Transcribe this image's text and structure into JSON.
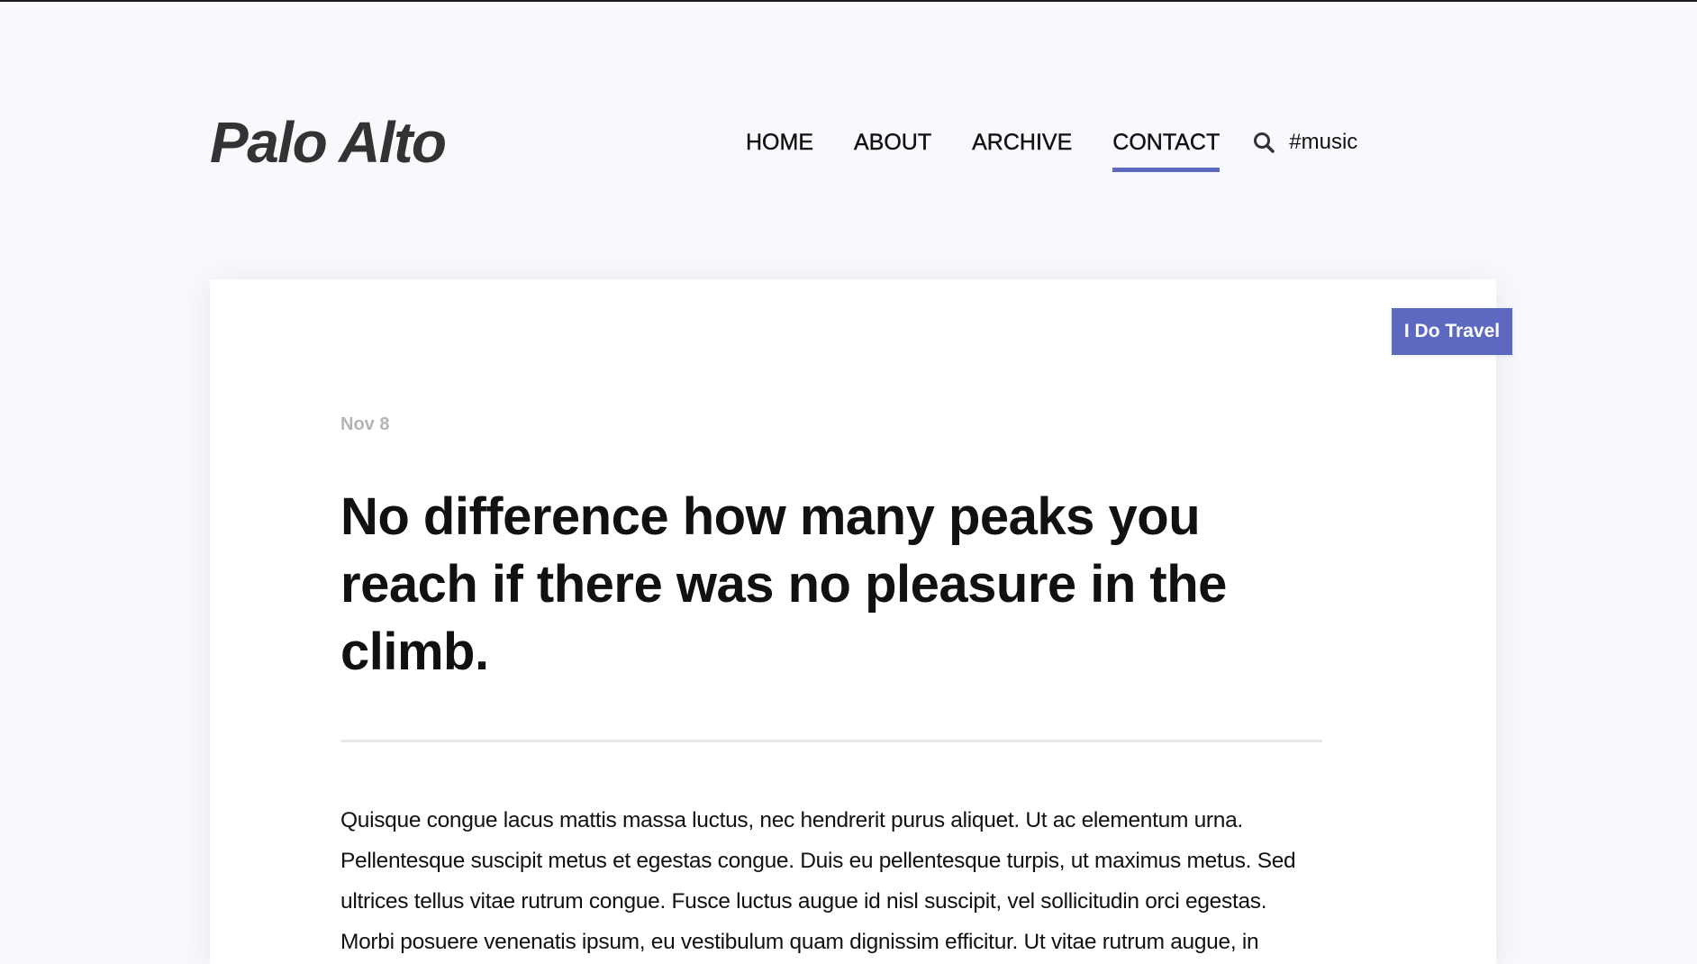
{
  "site": {
    "title": "Palo Alto"
  },
  "nav": {
    "items": [
      {
        "label": "HOME",
        "active": false
      },
      {
        "label": "ABOUT",
        "active": false
      },
      {
        "label": "ARCHIVE",
        "active": false
      },
      {
        "label": "CONTACT",
        "active": true
      }
    ],
    "search_icon": "search-icon",
    "search_text": "#music"
  },
  "post": {
    "tag": "I Do Travel",
    "date": "Nov 8",
    "title": "No difference how many peaks you reach if there was no pleasure in the climb.",
    "body": "Quisque congue lacus mattis massa luctus, nec hendrerit purus aliquet. Ut ac elementum urna. Pellentesque suscipit metus et egestas congue. Duis eu pellentesque turpis, ut maximus metus. Sed ultrices tellus vitae rutrum congue. Fusce luctus augue id nisl suscipit, vel sollicitudin orci egestas. Morbi posuere venenatis ipsum, eu vestibulum quam dignissim efficitur. Ut vitae rutrum augue, in"
  },
  "colors": {
    "accent": "#5d68c1",
    "page_background": "#f8f9fc",
    "card_background": "#ffffff",
    "date_text": "#b4b4b4"
  }
}
